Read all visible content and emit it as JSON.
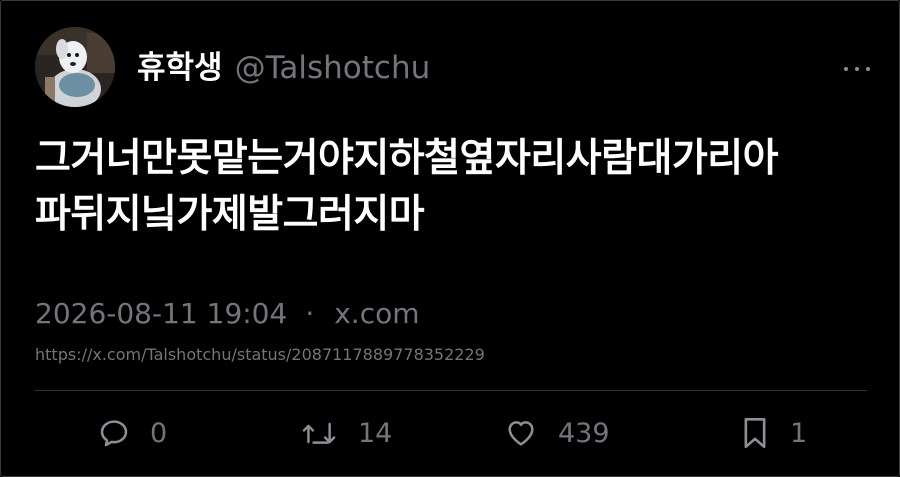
{
  "author": {
    "display_name": "휴학생",
    "handle": "@Talshotchu"
  },
  "tweet": {
    "text_line_1": "그거너만못맡는거야지하철옆자리사람대가리아",
    "text_line_2": "파뒤지닠가제발그러지마"
  },
  "meta": {
    "timestamp": "2026-08-11 19:04",
    "separator": "·",
    "source": "x.com",
    "status_url": "https://x.com/Talshotchu/status/2087117889778352229"
  },
  "actions": {
    "replies": "0",
    "retweets": "14",
    "likes": "439",
    "bookmarks": "1"
  },
  "icons": {
    "more": "more-horizontal-icon",
    "reply": "reply-icon",
    "retweet": "retweet-icon",
    "like": "heart-icon",
    "bookmark": "bookmark-icon"
  },
  "colors": {
    "background": "#000000",
    "text_primary": "#ffffff",
    "text_secondary": "#71767b",
    "divider": "#2f3336"
  }
}
